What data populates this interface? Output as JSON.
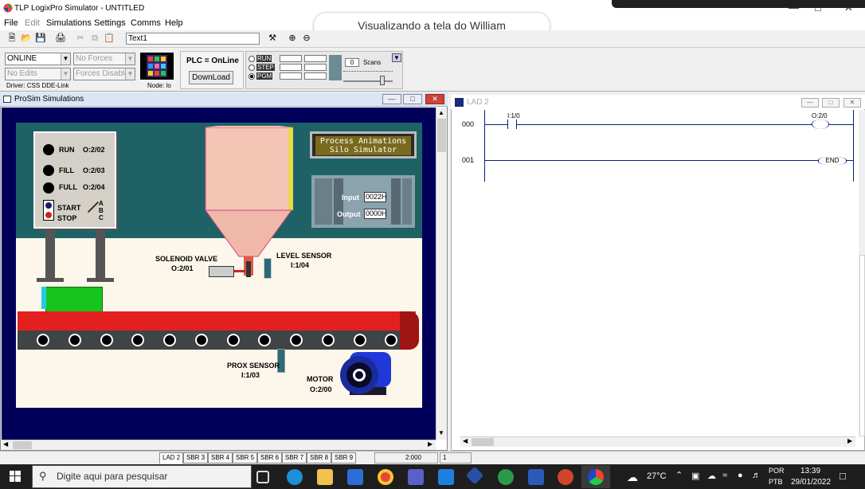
{
  "app": {
    "title": "TLP LogixPro Simulator  -  UNTITLED",
    "share_banner": "Visualizando a tela do William",
    "window_controls": [
      "—",
      "□",
      "✕"
    ]
  },
  "menu": {
    "items": [
      "File",
      "Edit",
      "Simulations",
      "Settings",
      "Comms",
      "Help"
    ]
  },
  "toolbar": {
    "tag_box_value": "Text1"
  },
  "plc_toolbar": {
    "online_select": "ONLINE",
    "forces_select": "No Forces",
    "edits_select": "No Edits",
    "forces_disabled_select": "Forces Disabled",
    "driver_text": "Driver: CSS DDE-Link",
    "node_text": "Node: lo",
    "plc_status": "PLC = OnLine",
    "download_button": "DownLoad",
    "modes": [
      "RUN",
      "STEP",
      "PGM"
    ],
    "selected_mode": "PGM",
    "scans_value": "0",
    "scans_label": "Scans"
  },
  "prosim_window": {
    "title": "ProSim Simulations",
    "simulation": {
      "title_line1": "Process Animations",
      "title_line2": "Silo Simulator",
      "indicators": [
        {
          "label": "RUN",
          "address": "O:2/02"
        },
        {
          "label": "FILL",
          "address": "O:2/03"
        },
        {
          "label": "FULL",
          "address": "O:2/04"
        }
      ],
      "start_label": "START",
      "stop_label": "STOP",
      "switch_positions": [
        "A",
        "B",
        "C"
      ],
      "solenoid_label": "SOLENOID VALVE",
      "solenoid_address": "O:2/01",
      "level_sensor_label": "LEVEL SENSOR",
      "level_sensor_address": "I:1/04",
      "prox_sensor_label": "PROX SENSOR",
      "prox_sensor_address": "I:1/03",
      "motor_label": "MOTOR",
      "motor_address": "O:2/00",
      "input_label": "Input",
      "input_value": "0022H",
      "output_label": "Output",
      "output_value": "0000H"
    }
  },
  "ladder_window": {
    "title": "LAD 2",
    "rungs": [
      {
        "number": "000",
        "contact": "I:1/0",
        "coil": "O:2/0"
      },
      {
        "number": "001",
        "end_label": "END"
      }
    ]
  },
  "statusbar": {
    "tabs": [
      "LAD 2",
      "SBR 3",
      "SBR 4",
      "SBR 5",
      "SBR 6",
      "SBR 7",
      "SBR 8",
      "SBR 9"
    ],
    "active_tab": "LAD 2",
    "field_1": "2:000",
    "field_2": "1"
  },
  "taskbar": {
    "search_placeholder": "Digite aqui para pesquisar",
    "weather": "27°C",
    "language_line1": "POR",
    "language_line2": "PTB",
    "time": "13:39",
    "date": "29/01/2022"
  },
  "colors": {
    "sim_background": "#00005a",
    "wall": "#1e6266",
    "conveyor_red": "#e32020",
    "box_green": "#16c41e",
    "ladder_wire": "#0a1e74"
  }
}
